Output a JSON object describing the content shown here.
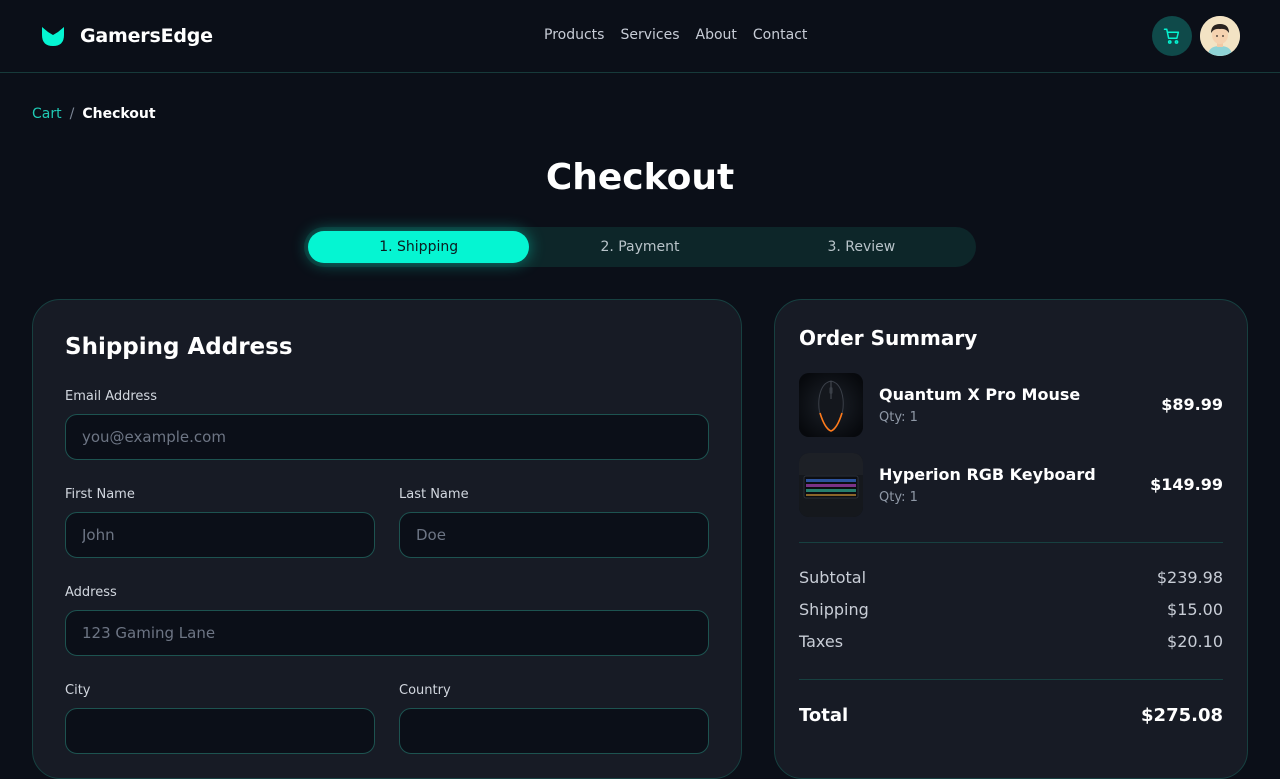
{
  "brand": {
    "name": "GamersEdge"
  },
  "nav": {
    "items": [
      "Products",
      "Services",
      "About",
      "Contact"
    ]
  },
  "breadcrumb": {
    "parent": "Cart",
    "separator": "/",
    "current": "Checkout"
  },
  "page": {
    "title": "Checkout"
  },
  "stepper": {
    "steps": [
      "1. Shipping",
      "2. Payment",
      "3. Review"
    ],
    "active_index": 0
  },
  "shipping": {
    "title": "Shipping Address",
    "email": {
      "label": "Email Address",
      "placeholder": "you@example.com",
      "value": ""
    },
    "first_name": {
      "label": "First Name",
      "placeholder": "John",
      "value": ""
    },
    "last_name": {
      "label": "Last Name",
      "placeholder": "Doe",
      "value": ""
    },
    "address": {
      "label": "Address",
      "placeholder": "123 Gaming Lane",
      "value": ""
    },
    "city": {
      "label": "City",
      "placeholder": "",
      "value": ""
    },
    "country": {
      "label": "Country",
      "value": ""
    }
  },
  "summary": {
    "title": "Order Summary",
    "items": [
      {
        "name": "Quantum X Pro Mouse",
        "qty": "Qty: 1",
        "price": "$89.99",
        "icon": "mouse-thumbnail"
      },
      {
        "name": "Hyperion RGB Keyboard",
        "qty": "Qty: 1",
        "price": "$149.99",
        "icon": "keyboard-thumbnail"
      }
    ],
    "subtotal": {
      "label": "Subtotal",
      "value": "$239.98"
    },
    "shipping": {
      "label": "Shipping",
      "value": "$15.00"
    },
    "taxes": {
      "label": "Taxes",
      "value": "$20.10"
    },
    "total": {
      "label": "Total",
      "value": "$275.08"
    }
  },
  "colors": {
    "accent": "#05f5d2",
    "background": "#0b0f18",
    "card": "#171b25",
    "border": "#174040",
    "link": "#1fc9b4"
  }
}
